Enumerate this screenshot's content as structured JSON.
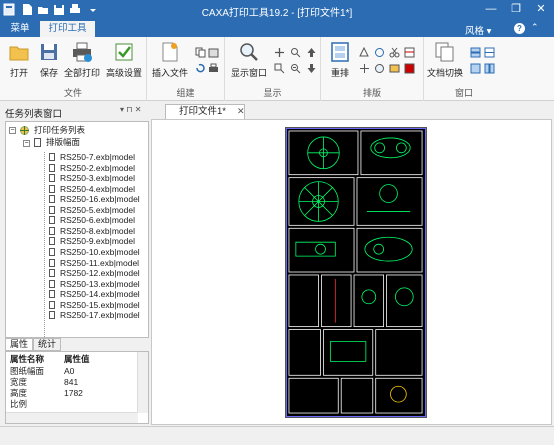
{
  "app": {
    "title": "CAXA打印工具19.2 - [打印文件1*]"
  },
  "window_controls": {
    "minimize": "—",
    "restore": "❐",
    "close": "✕"
  },
  "tabs": {
    "menu": "菜单",
    "print_tools": "打印工具",
    "style": "风格",
    "style_caret": "▾"
  },
  "ribbon": {
    "groups": {
      "file": "文件",
      "compose": "组建",
      "display": "显示",
      "layout": "排版",
      "window": "窗口"
    },
    "buttons": {
      "open": "打开",
      "save": "保存",
      "print_all": "全部打印",
      "advanced": "高级设置",
      "insert_file": "插入文件",
      "display_window": "显示窗口",
      "relayout": "重排",
      "doc_switch": "文档切换"
    }
  },
  "task_panel": {
    "title": "任务列表窗口",
    "controls": "▾ ⊓ ✕"
  },
  "doc_tab": {
    "label": "打印文件1*",
    "close": "✕"
  },
  "tree": {
    "root": "打印任务列表",
    "sheet": "排版幅面",
    "files": [
      "RS250-7.exb|model",
      "RS250-2.exb|model",
      "RS250-3.exb|model",
      "RS250-4.exb|model",
      "RS250-16.exb|model",
      "RS250-5.exb|model",
      "RS250-6.exb|model",
      "RS250-8.exb|model",
      "RS250-9.exb|model",
      "RS250-10.exb|model",
      "RS250-11.exb|model",
      "RS250-12.exb|model",
      "RS250-13.exb|model",
      "RS250-14.exb|model",
      "RS250-15.exb|model",
      "RS250-17.exb|model"
    ]
  },
  "prop_tabs": {
    "properties": "属性",
    "stats": "统计"
  },
  "properties": {
    "header": {
      "name": "属性名称",
      "value": "属性值"
    },
    "rows": [
      {
        "name": "图纸幅面",
        "value": "A0"
      },
      {
        "name": "宽度",
        "value": "841"
      },
      {
        "name": "高度",
        "value": "1782"
      },
      {
        "name": "比例",
        "value": ""
      }
    ]
  },
  "colors": {
    "accent": "#2b6cb3",
    "drawing_bg": "#000000",
    "drawing_line": "#00ff66"
  }
}
